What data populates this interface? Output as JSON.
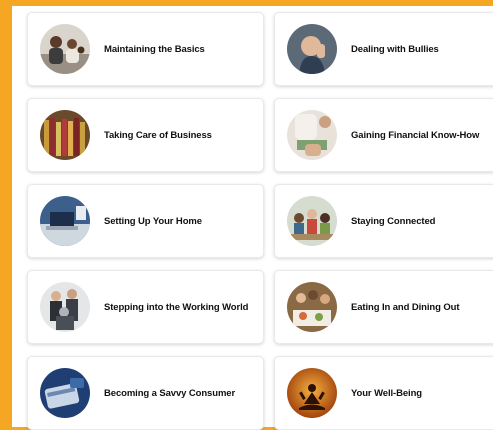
{
  "topics": [
    {
      "label": "Maintaining the Basics",
      "image": "family-on-couch-photo"
    },
    {
      "label": "Dealing with Bullies",
      "image": "upset-boy-photo"
    },
    {
      "label": "Taking Care of Business",
      "image": "file-folders-photo"
    },
    {
      "label": "Gaining Financial Know-How",
      "image": "counting-money-photo"
    },
    {
      "label": "Setting Up Your Home",
      "image": "laptop-desk-photo"
    },
    {
      "label": "Staying Connected",
      "image": "group-of-friends-photo"
    },
    {
      "label": "Stepping into the Working World",
      "image": "business-people-photo"
    },
    {
      "label": "Eating In and Dining Out",
      "image": "family-dinner-photo"
    },
    {
      "label": "Becoming a Savvy Consumer",
      "image": "credit-card-photo"
    },
    {
      "label": "Your Well-Being",
      "image": "meditation-silhouette-photo"
    }
  ],
  "colors": {
    "background": "#f5a623",
    "card": "#ffffff",
    "text": "#111111"
  }
}
